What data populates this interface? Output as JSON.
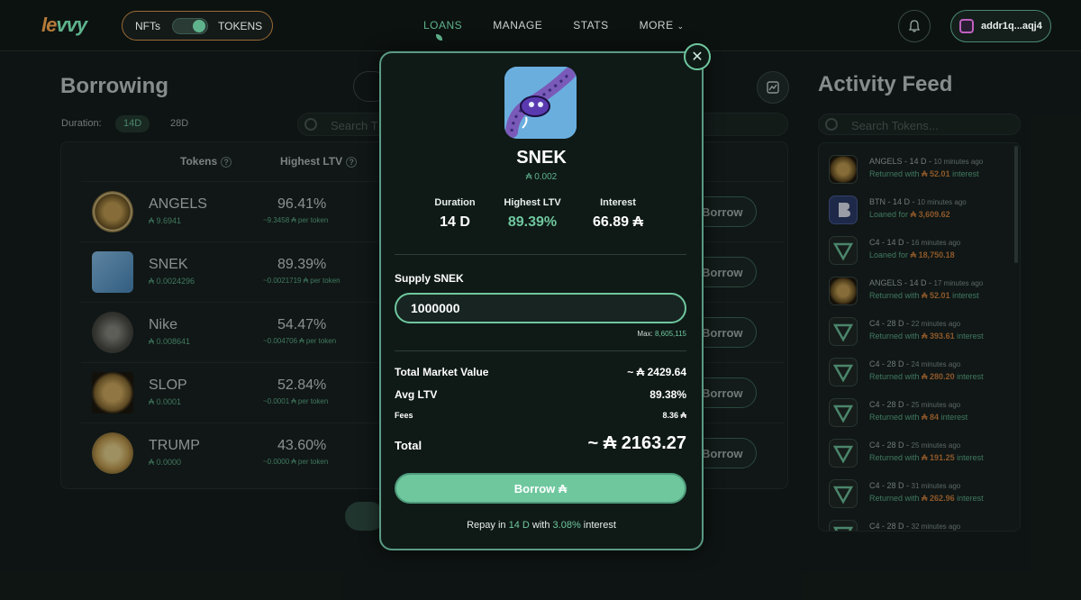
{
  "nav": {
    "logo_a": "le",
    "logo_b": "vvy",
    "toggle_left": "NFTs",
    "toggle_right": "TOKENS",
    "links": [
      "LOANS",
      "MANAGE",
      "STATS",
      "MORE"
    ],
    "wallet": "addr1q...aqj4"
  },
  "borrowing": {
    "title": "Borrowing",
    "duration_label": "Duration:",
    "durations": [
      "14D",
      "28D"
    ],
    "search_placeholder": "Search T",
    "col_tokens": "Tokens",
    "col_ltv": "Highest LTV",
    "q": "?",
    "borrow_label": "Borrow",
    "rows": [
      {
        "name": "ANGELS",
        "price": "₳ 9.6941",
        "ltv": "96.41%",
        "per_token": "~9.3458 ₳ per token"
      },
      {
        "name": "SNEK",
        "price": "₳ 0.0024296",
        "ltv": "89.39%",
        "per_token": "~0.0021719 ₳ per token"
      },
      {
        "name": "Nike",
        "price": "₳ 0.008641",
        "ltv": "54.47%",
        "per_token": "~0.004706 ₳ per token"
      },
      {
        "name": "SLOP",
        "price": "₳ 0.0001",
        "ltv": "52.84%",
        "per_token": "~0.0001 ₳ per token"
      },
      {
        "name": "TRUMP",
        "price": "₳ 0.0000",
        "ltv": "43.60%",
        "per_token": "~0.0000 ₳ per token"
      }
    ]
  },
  "feed": {
    "title": "Activity Feed",
    "search_placeholder": "Search Tokens...",
    "items": [
      {
        "head": "ANGELS  -  14 D  -",
        "time": "10 minutes ago",
        "pre": "Returned with",
        "amt": "₳ 52.01",
        "post": "interest"
      },
      {
        "head": "BTN  -  14 D  -",
        "time": "10 minutes ago",
        "pre": "Loaned for",
        "amt": "₳ 3,609.62",
        "post": ""
      },
      {
        "head": "C4  -  14 D  -",
        "time": "16 minutes ago",
        "pre": "Loaned for",
        "amt": "₳ 18,750.18",
        "post": ""
      },
      {
        "head": "ANGELS  -  14 D  -",
        "time": "17 minutes ago",
        "pre": "Returned with",
        "amt": "₳ 52.01",
        "post": "interest"
      },
      {
        "head": "C4  -  28 D  -",
        "time": "22 minutes ago",
        "pre": "Returned with",
        "amt": "₳ 393.61",
        "post": "interest"
      },
      {
        "head": "C4  -  28 D  -",
        "time": "24 minutes ago",
        "pre": "Returned with",
        "amt": "₳ 280.20",
        "post": "interest"
      },
      {
        "head": "C4  -  28 D  -",
        "time": "25 minutes ago",
        "pre": "Returned with",
        "amt": "₳ 84",
        "post": "interest"
      },
      {
        "head": "C4  -  28 D  -",
        "time": "25 minutes ago",
        "pre": "Returned with",
        "amt": "₳ 191.25",
        "post": "interest"
      },
      {
        "head": "C4  -  28 D  -",
        "time": "31 minutes ago",
        "pre": "Returned with",
        "amt": "₳ 262.96",
        "post": "interest"
      },
      {
        "head": "C4  -  28 D  -",
        "time": "32 minutes ago",
        "pre": "",
        "amt": "",
        "post": ""
      }
    ]
  },
  "modal": {
    "close": "✕",
    "title": "SNEK",
    "price": "₳ 0.002",
    "stats": [
      {
        "k": "Duration",
        "v": "14 D"
      },
      {
        "k": "Highest LTV",
        "v": "89.39%"
      },
      {
        "k": "Interest",
        "v": "66.89 ₳"
      }
    ],
    "supply_label": "Supply SNEK",
    "supply_value": "1000000",
    "max_label": "Max:",
    "max_value": "8,605,115",
    "total_market_label": "Total Market Value",
    "total_market_value": "~ ₳ 2429.64",
    "avg_ltv_label": "Avg LTV",
    "avg_ltv_value": "89.38%",
    "fees_label": "Fees",
    "fees_value": "8.36 ₳",
    "total_label": "Total",
    "total_value": "~ ₳ 2163.27",
    "borrow_button": "Borrow ₳",
    "repay_pre": "Repay in",
    "repay_days": "14 D",
    "repay_mid": "with",
    "repay_rate": "3.08%",
    "repay_post": "interest"
  }
}
